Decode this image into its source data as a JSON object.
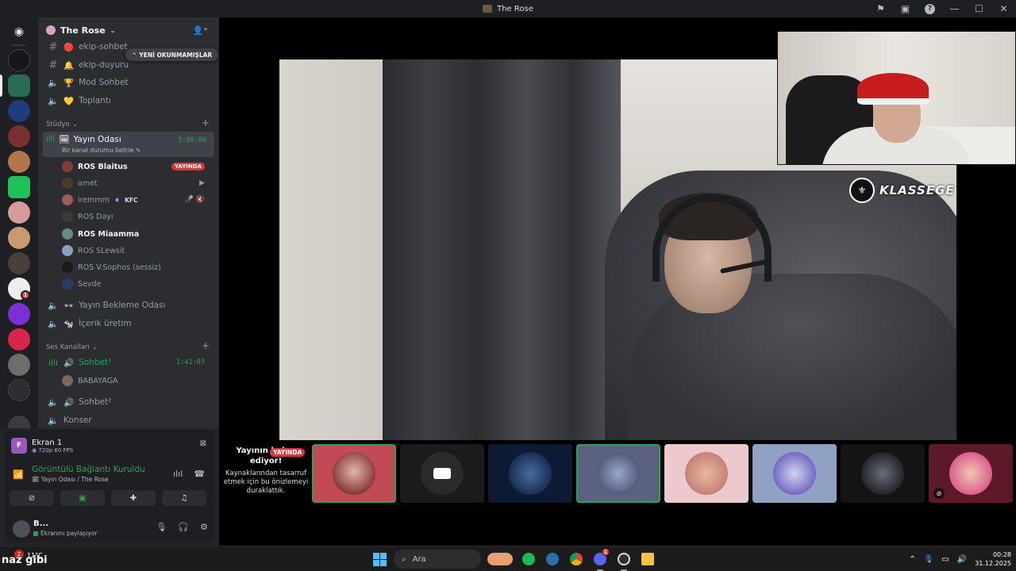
{
  "window": {
    "title": "The Rose"
  },
  "server": {
    "name": "The Rose",
    "new_unreads": "YENİ OKUNMAMIŞLAR"
  },
  "channels": {
    "top": [
      {
        "label": "ekip-sohbet",
        "kind": "text",
        "emoji": "🔴"
      },
      {
        "label": "ekip-duyuru",
        "kind": "text",
        "emoji": "🔔"
      },
      {
        "label": "Mod Sohbet",
        "kind": "voice",
        "emoji": "🏆"
      },
      {
        "label": "Toplantı",
        "kind": "voice",
        "emoji": "💛"
      }
    ],
    "category_studio": "Stüdyo",
    "stream_room": {
      "label": "Yayın Odası",
      "status": "Bir kanal durumu belirle",
      "timer": "3:00:06"
    },
    "stream_members": [
      {
        "name": "ROS Blaitus",
        "bold": true,
        "live": "YAYINDA"
      },
      {
        "name": "amet",
        "bold": false,
        "icon": "video-icon"
      },
      {
        "name": "iremmm",
        "bold": false,
        "tag": "KFC",
        "icon": "muted-icon"
      },
      {
        "name": "ROS Dayı",
        "bold": false
      },
      {
        "name": "ROS Miaamma",
        "bold": true
      },
      {
        "name": "ROS SLewsit",
        "bold": false
      },
      {
        "name": "ROS V.Sophos (sessiz)",
        "bold": false
      },
      {
        "name": "Sevde",
        "bold": false
      }
    ],
    "after_stream": [
      {
        "label": "Yayın Bekleme Odası"
      },
      {
        "label": "İçerik üretim"
      }
    ],
    "category_voice": "Ses Kanalları",
    "sohbet1": {
      "label": "Sohbet¹",
      "timer": "1:41:03"
    },
    "sohbet1_members": [
      {
        "name": "BABAYAGA"
      }
    ],
    "sohbet2": {
      "label": "Sohbet²"
    },
    "konser": {
      "label": "Konser"
    }
  },
  "voice_panel": {
    "screen_title": "Ekran 1",
    "screen_sub": "720p 60 FPS",
    "screen_icon_letter": "F",
    "connection_title": "Görüntülü Bağlantı Kuruldu",
    "connection_sub": "Yayın Odası / The Rose",
    "user_name": "B...",
    "user_status": "Ekranını paylaşıyor"
  },
  "stage": {
    "paused_title": "Yayının halen ediyor!",
    "paused_live": "YAYINDA",
    "paused_body": "Kaynaklarından tasarruf etmek için bu önizlemeyi duraklattık.",
    "brand_text": "KLASSEGE"
  },
  "tiles": [
    {
      "bg": "#c24a55",
      "selected": true
    },
    {
      "bg": "#1b1b1d",
      "camera": true
    },
    {
      "bg": "#0d1a33"
    },
    {
      "bg": "#5a6280",
      "selected": true
    },
    {
      "bg": "#ecc9cd"
    },
    {
      "bg": "#8fa2c3"
    },
    {
      "bg": "#141416"
    },
    {
      "bg": "#5c1a28",
      "muted": true
    }
  ],
  "taskbar": {
    "weather_text": "naz gibi",
    "temperature": "11°C",
    "weather_badge": "2",
    "search_label": "Ara",
    "time": "00:28",
    "date": "31.12.2025",
    "discord_badge": "1"
  }
}
